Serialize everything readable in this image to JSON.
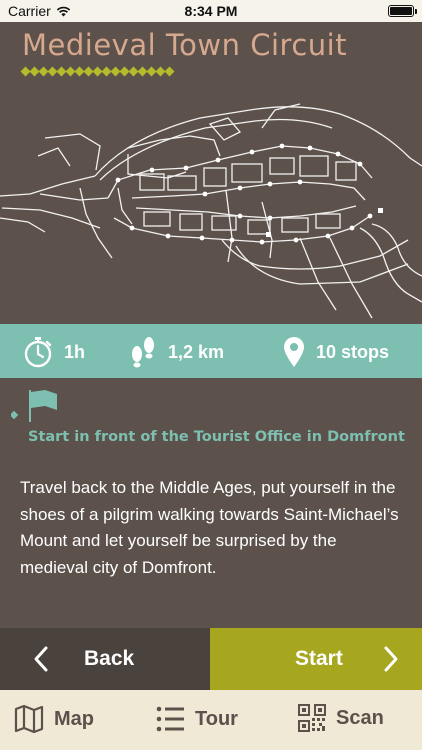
{
  "status_bar": {
    "carrier": "Carrier",
    "time": "8:34 PM"
  },
  "header": {
    "title": "Medieval Town Circuit"
  },
  "info": {
    "duration": "1h",
    "distance": "1,2 km",
    "stops": "10 stops"
  },
  "start_location": "Start in front of the Tourist Office in Domfront",
  "description": "Travel back to the Middle Ages, put yourself in the shoes of a pilgrim walking towards Saint-Michael’s Mount and let yourself be surprised by the medieval city of Domfront.",
  "nav": {
    "back_label": "Back",
    "start_label": "Start"
  },
  "tabs": [
    {
      "label": "Map",
      "icon": "map-icon"
    },
    {
      "label": "Tour",
      "icon": "list-icon"
    },
    {
      "label": "Scan",
      "icon": "qr-code-icon"
    }
  ],
  "colors": {
    "background": "#5c524b",
    "accent_teal": "#7dbfb0",
    "accent_olive": "#a7a61f",
    "title": "#d6a88f",
    "tab_bar": "#efe9d6"
  }
}
